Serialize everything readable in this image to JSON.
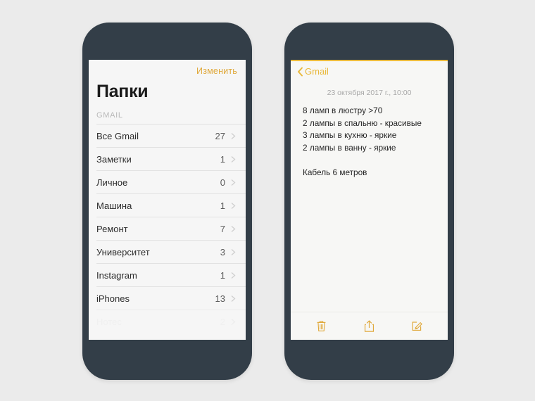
{
  "background_color": "#ebebeb",
  "accent_gold": "#e0a93c",
  "frame_color": "#333e48",
  "left_phone": {
    "name": "folders-screen",
    "edit_label": "Изменить",
    "title": "Папки",
    "section_header": "GMAIL",
    "folders": [
      {
        "name": "Все Gmail",
        "count": "27"
      },
      {
        "name": "Заметки",
        "count": "1"
      },
      {
        "name": "Личное",
        "count": "0"
      },
      {
        "name": "Машина",
        "count": "1"
      },
      {
        "name": "Ремонт",
        "count": "7"
      },
      {
        "name": "Университет",
        "count": "3"
      },
      {
        "name": "Instagram",
        "count": "1"
      },
      {
        "name": "iPhones",
        "count": "13"
      }
    ],
    "partial_row": {
      "name": "Нотес",
      "count": "2"
    }
  },
  "right_phone": {
    "name": "note-detail-screen",
    "back_label": "Gmail",
    "date": "23 октября 2017 г., 10:00",
    "note_text": "8 ламп в люстру >70\n2 лампы в спальню - красивые\n3 лампы в кухню - яркие\n2 лампы в ванну - яркие\n\nКабель 6 метров",
    "toolbar": [
      {
        "icon": "trash-icon",
        "label": "Удалить"
      },
      {
        "icon": "share-icon",
        "label": "Поделиться"
      },
      {
        "icon": "compose-icon",
        "label": "Создать"
      }
    ]
  }
}
